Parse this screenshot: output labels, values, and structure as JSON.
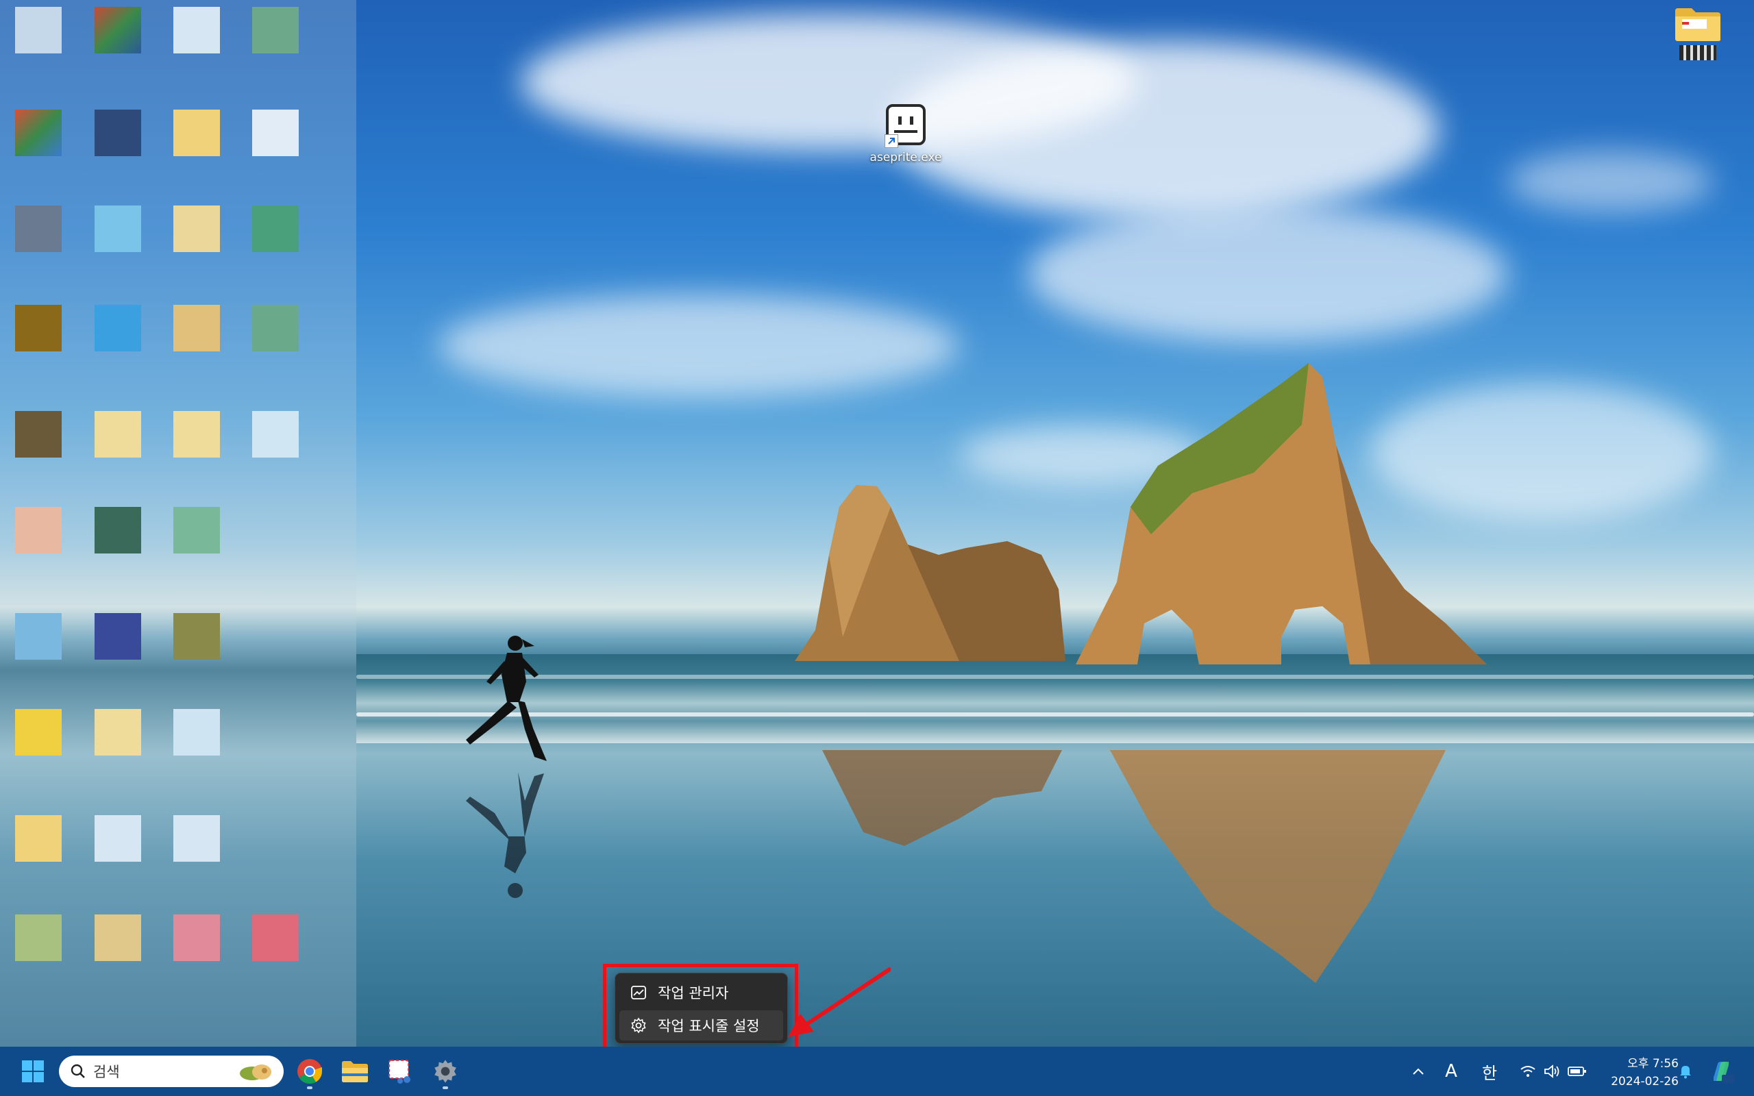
{
  "desktop": {
    "icons": [
      {
        "label": "aseprite.exe",
        "icon": "aseprite-app-icon",
        "shortcut": true
      },
      {
        "label": "",
        "icon": "folder-icon",
        "label_obscured": true
      }
    ]
  },
  "context_menu": {
    "items": [
      {
        "label": "작업 관리자",
        "icon": "task-manager-icon"
      },
      {
        "label": "작업 표시줄 설정",
        "icon": "gear-icon"
      }
    ]
  },
  "taskbar": {
    "search_placeholder": "검색",
    "apps": [
      {
        "name": "start",
        "icon": "windows-logo-icon"
      },
      {
        "name": "chrome",
        "icon": "chrome-icon"
      },
      {
        "name": "file-explorer",
        "icon": "folder-icon"
      },
      {
        "name": "snipping-tool",
        "icon": "snipping-tool-icon"
      },
      {
        "name": "settings",
        "icon": "gear-icon"
      }
    ],
    "tray": {
      "ime_mode": "A",
      "ime_lang": "한",
      "time": "오후 7:56",
      "date": "2024-02-26"
    }
  },
  "colors": {
    "taskbar": "#0f4a8a",
    "menu_bg": "#2b2b2b",
    "annotation_red": "#e8141b"
  }
}
